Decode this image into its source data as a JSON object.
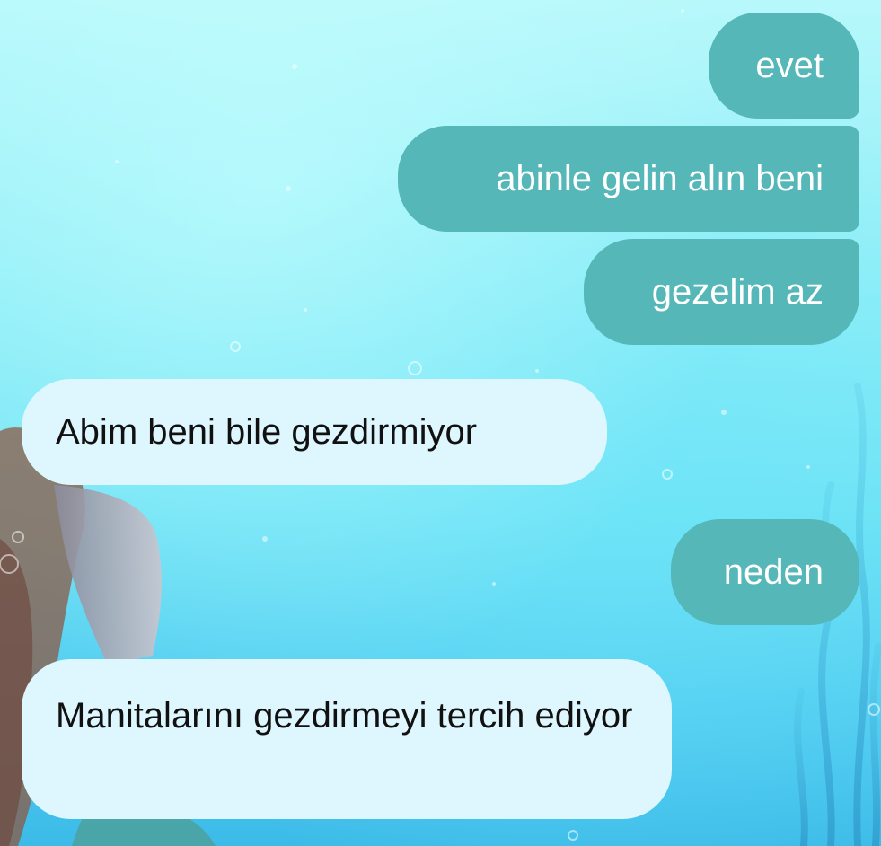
{
  "colors": {
    "outgoing_bubble": "#55b7b8",
    "incoming_bubble": "#def6fd",
    "outgoing_text": "#ffffff",
    "incoming_text": "#111111",
    "background_top": "#b7f8fb",
    "background_bottom": "#3cbbe8"
  },
  "messages": [
    {
      "direction": "outgoing",
      "text": "evet"
    },
    {
      "direction": "outgoing",
      "text": "abinle gelin alın beni"
    },
    {
      "direction": "outgoing",
      "text": "gezelim az"
    },
    {
      "direction": "incoming",
      "text": "Abim beni bile gezdirmiyor"
    },
    {
      "direction": "outgoing",
      "text": "neden"
    },
    {
      "direction": "incoming",
      "text": "Manitalarını gezdirmeyi tercih ediyor"
    }
  ]
}
